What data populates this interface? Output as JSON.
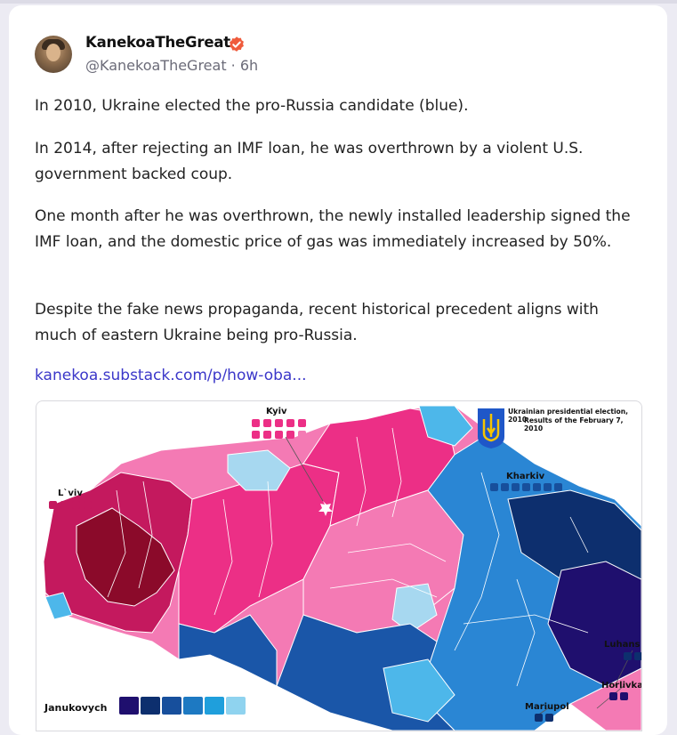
{
  "post": {
    "author_name": "KanekoaTheGreat",
    "handle_time": "@KanekoaTheGreat · 6h",
    "paragraphs": [
      "In 2010, Ukraine elected the pro-Russia candidate (blue).",
      "In 2014, after rejecting an IMF loan, he was overthrown by a violent U.S. government backed coup.",
      "One month after he was overthrown, the newly installed leadership signed the IMF loan, and the domestic price of gas was immediately increased by 50%.",
      "Despite the fake news propaganda, recent historical precedent aligns with much of eastern Ukraine being pro-Russia."
    ],
    "link_text": "kanekoa.substack.com/p/how-oba..."
  },
  "map": {
    "title_line1": "Ukrainian presidential election, 2010",
    "title_line2": "Results of the February 7, 2010",
    "labels": {
      "kyiv": "Kyiv",
      "lviv": "L`viv",
      "kharkiv": "Kharkiv",
      "luhansk": "Luhans",
      "horlivka": "Horlivka",
      "mariupol": "Mariupol",
      "legend": "Janukovych"
    },
    "colors": {
      "tymoshenko_dark": "#8b0a2a",
      "tymoshenko_mid": "#c4195e",
      "tymoshenko_pink": "#ec2f86",
      "tymoshenko_light": "#f47ab4",
      "yanukovych_dark": "#0d1f5e",
      "yanukovych_mid": "#1a56a8",
      "yanukovych_blue": "#2a86d4",
      "yanukovych_light": "#4db7ea"
    },
    "legend_colors": [
      "#1f0f6e",
      "#0d2f6e",
      "#174f9c",
      "#1d79c2",
      "#1f9fdc",
      "#8fd3ef"
    ]
  }
}
